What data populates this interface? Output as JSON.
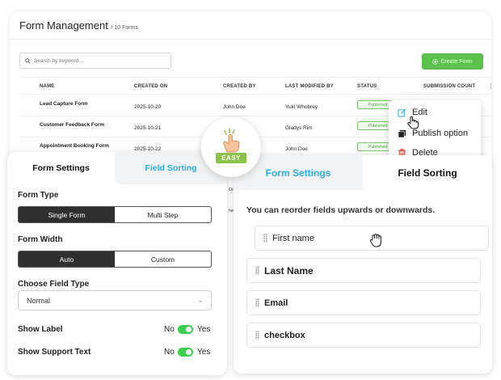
{
  "form_management": {
    "title": "Form Management",
    "count": "/ 10 Forms",
    "search_placeholder": "Search by keyword...",
    "create_button": "Create Form",
    "columns": [
      "NAME",
      "CREATED ON",
      "CREATED BY",
      "LAST MODIFIED BY",
      "STATUS",
      "SUBMISSION COUNT"
    ],
    "rows": [
      {
        "name": "Lead Capture Form",
        "created_on": "2025-10-20",
        "created_by": "John Doe",
        "modified_by": "Yuki Whobrey",
        "status": "Published"
      },
      {
        "name": "Customer Feedback Form",
        "created_on": "2025-10-21",
        "created_by": "",
        "modified_by": "Gladys Rim",
        "status": "Published"
      },
      {
        "name": "Appointment Booking Form",
        "created_on": "2025-10-22",
        "created_by": "",
        "modified_by": "John Doe",
        "status": "Published"
      }
    ],
    "peek_texts": [
      "Do",
      "he"
    ]
  },
  "context_menu": {
    "items": [
      {
        "label": "Edit",
        "icon": "edit-icon"
      },
      {
        "label": "Publish option",
        "icon": "copy-icon"
      },
      {
        "label": "Delete",
        "icon": "trash-icon"
      }
    ]
  },
  "badge": {
    "label": "EASY",
    "icon": "thumbs-up-hand-icon"
  },
  "form_settings_panel": {
    "tabs": {
      "settings": "Form Settings",
      "sorting": "Field Sorting"
    },
    "form_type_label": "Form Type",
    "form_type_options": [
      "Single Form",
      "Multi Step"
    ],
    "form_width_label": "Form Width",
    "form_width_options": [
      "Auto",
      "Custom"
    ],
    "field_type_label": "Choose Field Type",
    "field_type_value": "Normal",
    "show_label": {
      "label": "Show Label",
      "off": "No",
      "on": "Yes"
    },
    "show_support": {
      "label": "Show Support Text",
      "off": "No",
      "on": "Yes"
    }
  },
  "field_sorting_panel": {
    "tabs": {
      "settings": "Form Settings",
      "sorting": "Field Sorting"
    },
    "description": "You can reorder fields upwards or downwards.",
    "fields": [
      "First name",
      "Last Name",
      "Email",
      "checkbox"
    ]
  },
  "colors": {
    "accent": "#29aee6",
    "green": "#5ac24a",
    "toggle": "#3ccf4e",
    "delete": "#e53935"
  }
}
